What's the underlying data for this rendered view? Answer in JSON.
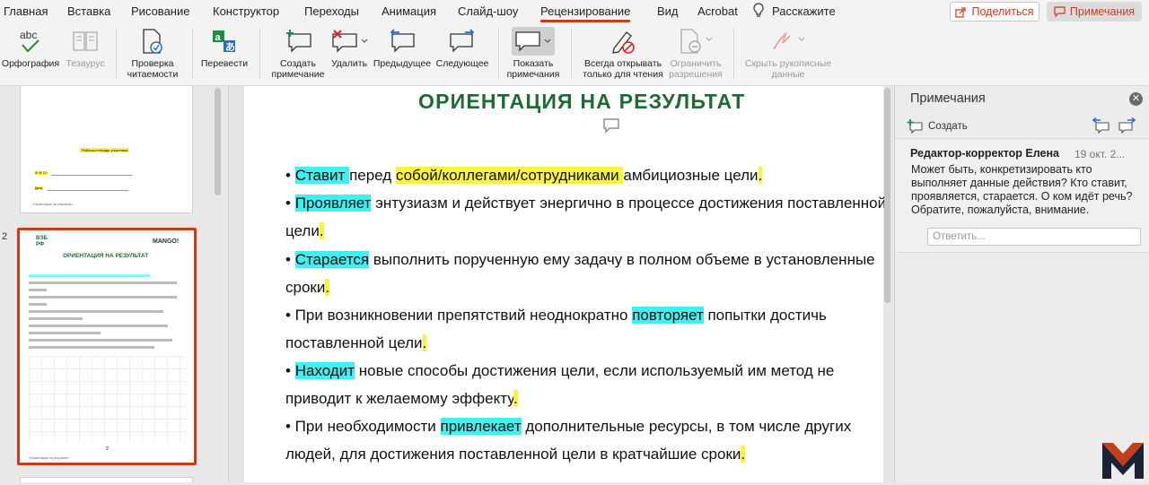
{
  "menu": {
    "tabs": [
      "Главная",
      "Вставка",
      "Рисование",
      "Конструктор",
      "Переходы",
      "Анимация",
      "Слайд-шоу",
      "Рецензирование",
      "Вид",
      "Acrobat",
      "Расскажите"
    ],
    "share": "Поделиться",
    "comments": "Примечания"
  },
  "ribbon": {
    "spelling": "Орфография",
    "thesaurus": "Тезаурус",
    "accessibility1": "Проверка",
    "accessibility2": "читаемости",
    "translate": "Перевести",
    "new_comment1": "Создать",
    "new_comment2": "примечание",
    "delete": "Удалить",
    "previous": "Предыдущее",
    "next": "Следующее",
    "show_comments1": "Показать",
    "show_comments2": "примечания",
    "always_open1": "Всегда открывать",
    "always_open2": "только для чтения",
    "restrict1": "Ограничить",
    "restrict2": "разрешения",
    "hide_ink1": "Скрыть рукописные",
    "hide_ink2": "данные"
  },
  "thumbnails": {
    "slide1_title": "Рабочая тетрадь участника",
    "slide1_field1": "Ф. И. О.:",
    "slide1_field2": "Дата:",
    "slide1_footer": "«Ориентация на результат»",
    "slide2_number": "2",
    "slide2_logo_left": "ВЭБ РФ",
    "slide2_logo_right": "MANGO!",
    "slide2_title": "ОРИЕНТАЦИЯ НА РЕЗУЛЬТАТ",
    "slide2_page": "2",
    "slide2_footer": "«Ориентация на результат»"
  },
  "slide": {
    "title": "ОРИЕНТАЦИЯ НА РЕЗУЛЬТАТ",
    "lines": [
      {
        "a": "• ",
        "h1": "Ставит ",
        "b": "перед ",
        "h2": "собой/коллегами/сотрудниками ",
        "c": "амбициозные цели",
        "e": "."
      },
      {
        "a": "• ",
        "h1": "Проявляет",
        "b": " энтузиазм и действует энергично в процессе достижения поставленной"
      },
      {
        "a": "цели",
        "e": "."
      },
      {
        "a": "• ",
        "h1": "Старается",
        "b": " выполнить порученную ему задачу в полном объеме в установленные"
      },
      {
        "a": "сроки",
        "e": "."
      },
      {
        "a": "• При возникновении препятствий неоднократно ",
        "h1": "повторяет",
        "b": " попытки достичь"
      },
      {
        "a": "поставленной цели",
        "e": "."
      },
      {
        "a": "• ",
        "h1": "Находит",
        "b": " новые способы достижения цели, если используемый им метод не"
      },
      {
        "a": "приводит к желаемому эффекту",
        "e": "."
      },
      {
        "a": "• При необходимости ",
        "h1": "привлекает",
        "b": " дополнительные ресурсы, в том числе других"
      },
      {
        "a": "людей, для достижения поставленной цели в кратчайшие сроки",
        "e": "."
      }
    ]
  },
  "panel": {
    "title": "Примечания",
    "new": "Создать",
    "author": "Редактор-корректор Елена",
    "date": "19 окт. 2...",
    "text1": "Может быть, конкретизировать кто",
    "text2": "выполняет данные действия? Кто ставит,",
    "text3": "проявляется, старается. О ком идёт речь?",
    "text4": "Обратите, пожалуйста, внимание.",
    "reply_placeholder": "Ответить..."
  },
  "colors": {
    "accent": "#c43e1c",
    "title_green": "#1e6a33",
    "highlight_cyan": "#3ff0f0",
    "highlight_yellow": "#fbf23a"
  }
}
